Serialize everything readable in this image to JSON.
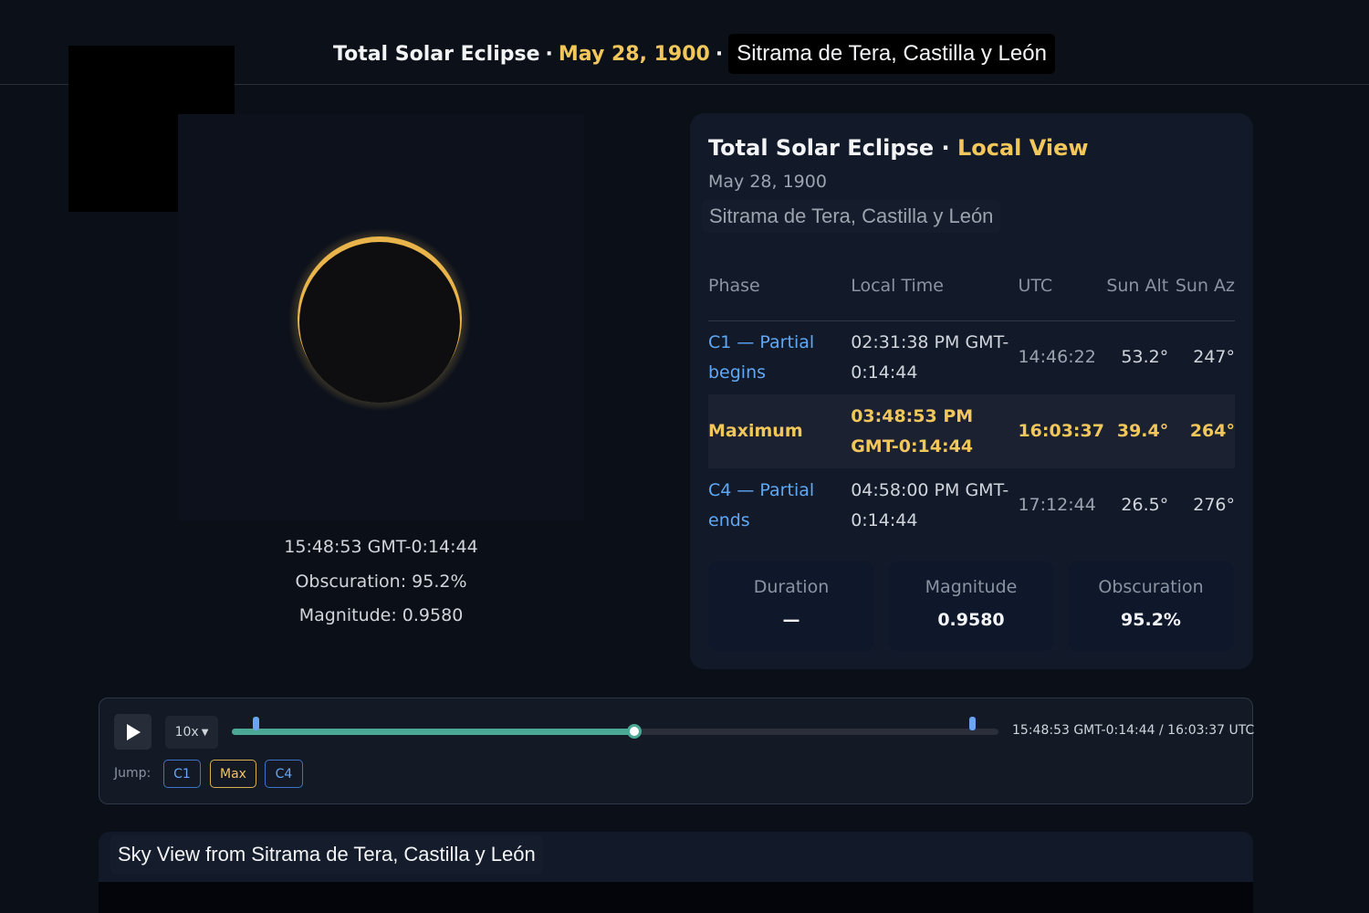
{
  "header": {
    "title": "Total Solar Eclipse",
    "separator": "·",
    "date": "May 28, 1900",
    "location": "Sitrama de Tera, Castilla y León"
  },
  "readout": {
    "time": "15:48:53 GMT-0:14:44",
    "obscuration": "Obscuration: 95.2%",
    "magnitude": "Magnitude: 0.9580"
  },
  "card": {
    "title": "Total Solar Eclipse",
    "separator": "·",
    "subtitle": "Local View",
    "date": "May 28, 1900",
    "location": "Sitrama de Tera, Castilla y León",
    "columns": [
      "Phase",
      "Local Time",
      "UTC",
      "Sun Alt",
      "Sun Az"
    ],
    "rows": [
      {
        "phase": "C1 — Partial begins",
        "local": "02:31:38 PM GMT-0:14:44",
        "utc": "14:46:22",
        "alt": "53.2°",
        "az": "247°"
      },
      {
        "phase": "Maximum",
        "local": "03:48:53 PM GMT-0:14:44",
        "utc": "16:03:37",
        "alt": "39.4°",
        "az": "264°"
      },
      {
        "phase": "C4 — Partial ends",
        "local": "04:58:00 PM GMT-0:14:44",
        "utc": "17:12:44",
        "alt": "26.5°",
        "az": "276°"
      }
    ],
    "stats": {
      "duration_label": "Duration",
      "duration_value": "—",
      "magnitude_label": "Magnitude",
      "magnitude_value": "0.9580",
      "obscuration_label": "Obscuration",
      "obscuration_value": "95.2%"
    }
  },
  "player": {
    "play_icon": "play-icon",
    "speed": "10x",
    "progress_fraction": 0.525,
    "c1_fraction": 0.031,
    "c4_fraction": 0.965,
    "time_readout": "15:48:53 GMT-0:14:44 / 16:03:37 UTC",
    "jump_label": "Jump:",
    "jump_buttons": [
      "C1",
      "Max",
      "C4"
    ]
  },
  "sky": {
    "title": "Sky View from Sitrama de Tera, Castilla y León"
  },
  "colors": {
    "accent_gold": "#f1c75b",
    "link_blue": "#5fa8f5",
    "progress_teal": "#4aa894",
    "background": "#0b0f17"
  }
}
